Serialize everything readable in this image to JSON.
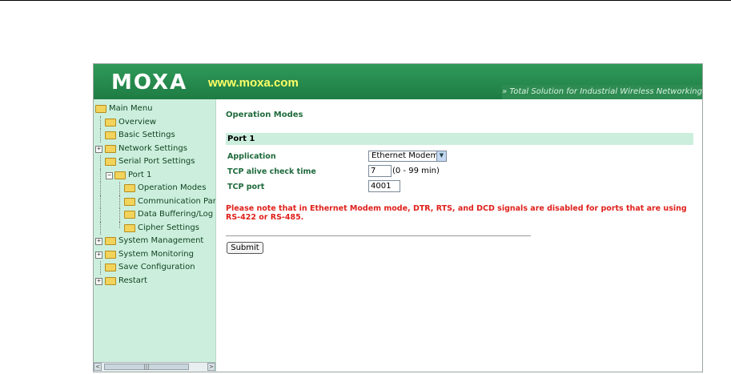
{
  "brand": {
    "logo": "MOXA",
    "site": "www.moxa.com",
    "slogan": "» Total Solution for Industrial Wireless Networking"
  },
  "menu": {
    "items": [
      {
        "label": "Main Menu"
      },
      {
        "label": "Overview"
      },
      {
        "label": "Basic Settings"
      },
      {
        "label": "Network Settings"
      },
      {
        "label": "Serial Port Settings"
      },
      {
        "label": "Port 1"
      },
      {
        "label": "Operation Modes"
      },
      {
        "label": "Communication Para"
      },
      {
        "label": "Data Buffering/Log"
      },
      {
        "label": "Cipher Settings"
      },
      {
        "label": "System Management"
      },
      {
        "label": "System Monitoring"
      },
      {
        "label": "Save Configuration"
      },
      {
        "label": "Restart"
      }
    ]
  },
  "main": {
    "title": "Operation Modes",
    "section": "Port 1",
    "fields": {
      "application_label": "Application",
      "application_value": "Ethernet Modem",
      "tcp_alive_label": "TCP alive check time",
      "tcp_alive_value": "7",
      "tcp_alive_hint": "(0 - 99 min)",
      "tcp_port_label": "TCP port",
      "tcp_port_value": "4001"
    },
    "warning": "Please note that in Ethernet Modem mode, DTR, RTS, and DCD signals are disabled for ports that are using RS-422 or RS-485.",
    "submit_label": "Submit"
  },
  "colors": {
    "banner": "#1e7c43",
    "sidebar": "#ccefdd",
    "heading": "#1e6a3c",
    "warning": "#e0201b",
    "site_text": "#ffff66"
  }
}
